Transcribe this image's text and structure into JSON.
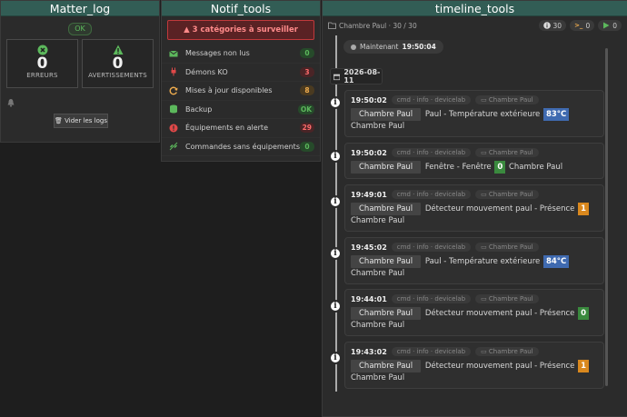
{
  "matter_log": {
    "title": "Matter_log",
    "status": "OK",
    "errors_count": "0",
    "errors_label": "ERREURS",
    "warnings_count": "0",
    "warnings_label": "AVERTISSEMENTS",
    "clear_button": "Vider les logs"
  },
  "notif_tools": {
    "title": "Notif_tools",
    "alert": "3 catégories à surveiller",
    "rows": [
      {
        "label": "Messages non lus",
        "count": "0",
        "icon": "envelope-icon",
        "badge": "green"
      },
      {
        "label": "Démons KO",
        "count": "3",
        "icon": "plug-icon",
        "badge": "red"
      },
      {
        "label": "Mises à jour disponibles",
        "count": "8",
        "icon": "refresh-icon",
        "badge": "orange"
      },
      {
        "label": "Backup",
        "count": "OK",
        "icon": "database-icon",
        "badge": "green"
      },
      {
        "label": "Équipements en alerte",
        "count": "29",
        "icon": "alert-circle-icon",
        "badge": "red"
      },
      {
        "label": "Commandes sans équipements",
        "count": "0",
        "icon": "unlink-icon",
        "badge": "green"
      }
    ]
  },
  "timeline_tools": {
    "title": "timeline_tools",
    "breadcrumb": "Chambre Paul · 30 / 30",
    "pills": {
      "info": "30",
      "cmd": "0",
      "run": "0"
    },
    "now_label": "Maintenant",
    "now_time": "19:50:04",
    "date": "2026-08-11",
    "events": [
      {
        "time": "19:50:02",
        "meta": "cmd · info · devicelab",
        "room": "Chambre Paul",
        "eq": "Chambre Paul",
        "text": "Paul - Température extérieure",
        "value": "83°C",
        "vclass": "v-blue",
        "suffix": "Chambre Paul"
      },
      {
        "time": "19:50:02",
        "meta": "cmd · info · devicelab",
        "room": "Chambre Paul",
        "eq": "Chambre Paul",
        "text": "Fenêtre - Fenêtre",
        "value": "0",
        "vclass": "v-green",
        "suffix": "Chambre Paul"
      },
      {
        "time": "19:49:01",
        "meta": "cmd · info · devicelab",
        "room": "Chambre Paul",
        "eq": "Chambre Paul",
        "text": "Détecteur mouvement paul - Présence",
        "value": "1",
        "vclass": "v-orange",
        "suffix": "Chambre Paul"
      },
      {
        "time": "19:45:02",
        "meta": "cmd · info · devicelab",
        "room": "Chambre Paul",
        "eq": "Chambre Paul",
        "text": "Paul - Température extérieure",
        "value": "84°C",
        "vclass": "v-blue",
        "suffix": "Chambre Paul"
      },
      {
        "time": "19:44:01",
        "meta": "cmd · info · devicelab",
        "room": "Chambre Paul",
        "eq": "Chambre Paul",
        "text": "Détecteur mouvement paul - Présence",
        "value": "0",
        "vclass": "v-green",
        "suffix": "Chambre Paul"
      },
      {
        "time": "19:43:02",
        "meta": "cmd · info · devicelab",
        "room": "Chambre Paul",
        "eq": "Chambre Paul",
        "text": "Détecteur mouvement paul - Présence",
        "value": "1",
        "vclass": "v-orange",
        "suffix": "Chambre Paul"
      }
    ]
  },
  "colors": {
    "header": "#325d55",
    "danger": "#c0393b",
    "ok": "#5cb85c",
    "warn": "#f0ad4e",
    "info": "#3f6ab0"
  }
}
